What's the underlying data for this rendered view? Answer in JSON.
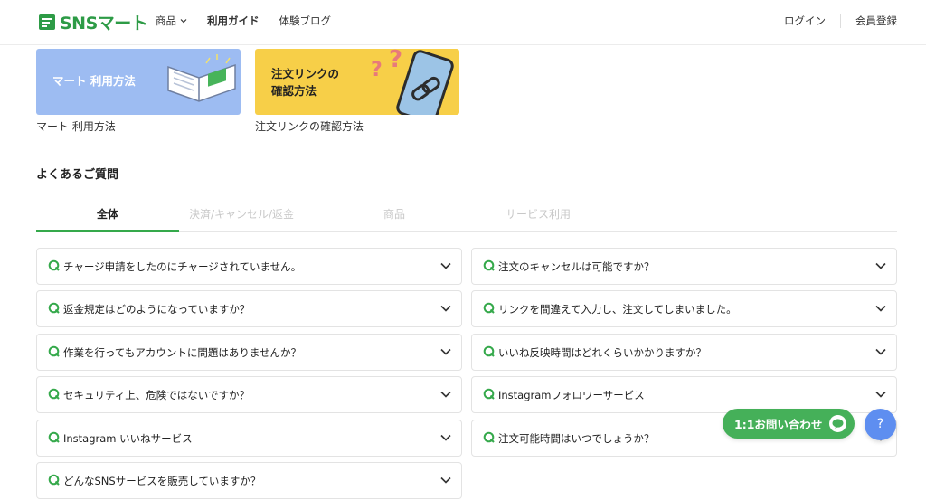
{
  "header": {
    "logo_text": "SNSマート",
    "nav": [
      {
        "label": "商品"
      },
      {
        "label": "利用ガイド"
      },
      {
        "label": "体験ブログ"
      }
    ],
    "login_label": "ログイン",
    "register_label": "会員登録"
  },
  "guides": [
    {
      "card_title_1": "マート 利用方法",
      "card_title_2": "",
      "caption": "マート 利用方法",
      "color": "#9dbcf2"
    },
    {
      "card_title_1": "注文リンクの",
      "card_title_2": "確認方法",
      "caption": "注文リンクの確認方法",
      "color": "#f7cf48"
    }
  ],
  "faq": {
    "heading": "よくあるご質問",
    "tabs": [
      {
        "label": "全体",
        "active": true
      },
      {
        "label": "決済/キャンセル/返金",
        "active": false
      },
      {
        "label": "商品",
        "active": false
      },
      {
        "label": "サービス利用",
        "active": false
      }
    ],
    "left": [
      "チャージ申請をしたのにチャージされていません。",
      "返金規定はどのようになっていますか？",
      "作業を行ってもアカウントに問題はありませんか？",
      "セキュリティ上、危険ではないですか？",
      "Instagram いいねサービス",
      "どんなSNSサービスを販売していますか？"
    ],
    "right": [
      "注文のキャンセルは可能ですか？",
      "リンクを間違えて入力し、注文してしまいました。",
      "いいね反映時間はどれくらいかかりますか？",
      "Instagramフォロワーサービス",
      "注文可能時間はいつでしょうか？"
    ]
  },
  "floating": {
    "contact_label": "1:1お問い合わせ",
    "help_label": "?"
  },
  "colors": {
    "brand": "#2d9b46",
    "accent_green": "#35a94b",
    "contact_bg": "#45b059",
    "help_bg": "#5e8ef0"
  }
}
